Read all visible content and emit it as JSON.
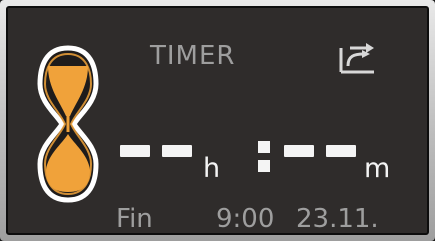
{
  "timer": {
    "title": "TIMER",
    "hours_unit": "h",
    "minutes_unit": "m",
    "finish_label": "Fin",
    "finish_time": "9:00",
    "finish_date": "23.11."
  },
  "icons": {
    "left": "hourglass-icon",
    "top_right": "return-arrow-icon"
  },
  "colors": {
    "accent": "#f0a23a",
    "screen_bg": "#2f2c2b",
    "digits": "#f4f4f4",
    "labels": "#9e9e9e"
  }
}
